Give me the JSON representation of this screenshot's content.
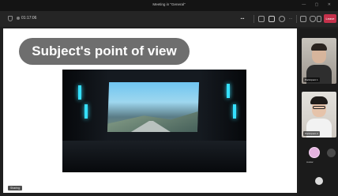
{
  "window": {
    "title": "Meeting in \"General\"",
    "controls": "— ▢ ✕"
  },
  "toolbar": {
    "timer": "01:17:06",
    "more_label": "•••",
    "leave_label": "Leave"
  },
  "slide": {
    "title": "Subject's point of view"
  },
  "stage": {
    "label": "Sharing"
  },
  "participants": [
    {
      "name": "Participant 1"
    },
    {
      "name": "Participant 2"
    }
  ],
  "rail": {
    "avatar_label": "Avatar"
  },
  "colors": {
    "leave": "#c4314b",
    "slide_pill": "#6e6e6e",
    "accent_light": "#35e0ff"
  }
}
